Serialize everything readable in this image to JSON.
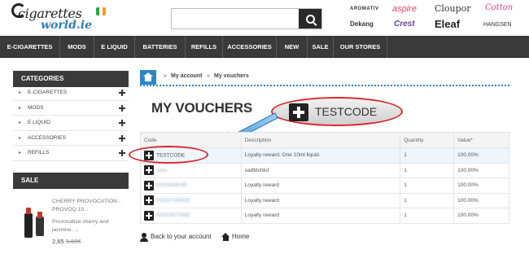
{
  "header": {
    "logo": {
      "main": "cigarettes",
      "sub": "world.ie"
    },
    "search": {
      "placeholder": "",
      "value": ""
    },
    "brands": [
      "AROMATIV",
      "aspire",
      "Cloupor",
      "Cotton",
      "Dekang",
      "Crest",
      "Eleaf",
      "HANGSEN"
    ]
  },
  "nav": {
    "items": [
      "E-CIGARETTES",
      "MODS",
      "E LIQUID",
      "BATTERIES",
      "REFILLS",
      "ACCESSORIES",
      "NEW",
      "SALE",
      "OUR STORES"
    ]
  },
  "sidebar": {
    "categories_title": "CATEGORIES",
    "categories": [
      "E-CIGARETTES",
      "MODS",
      "E LIQUID",
      "ACCESSORIES",
      "REFILLS"
    ],
    "sale_title": "SALE",
    "product": {
      "name": "CHERRY PROVOCATION - PROVOQ.10...",
      "desc": "Provocative cherry and jasmine, ...",
      "price": "2,65",
      "old_price": "3,66",
      "currency": "€"
    }
  },
  "breadcrumb": {
    "items": [
      "My account",
      "My vouchers"
    ],
    "separator": "»"
  },
  "main": {
    "title": "MY VOUCHERS",
    "callout_code": "TESTCODE",
    "table": {
      "headers": [
        "Code",
        "Description",
        "Quantity",
        "Value*"
      ],
      "rows": [
        {
          "code": "TESTCODE",
          "description": "Loyalty reward. One 10ml liquid.",
          "quantity": "1",
          "value": "100.00%"
        },
        {
          "code": "xxxx",
          "description": "sadfdsfdsf",
          "quantity": "1",
          "value": "100.00%"
        },
        {
          "code": "ECIG428140",
          "description": "Loyalty reward",
          "quantity": "1",
          "value": "100.00%"
        },
        {
          "code": "ECIG7145015",
          "description": "Loyalty reward",
          "quantity": "1",
          "value": "100.00%"
        },
        {
          "code": "ECIG2677846",
          "description": "Loyalty reward",
          "quantity": "1",
          "value": "100.00%"
        }
      ]
    },
    "footer": {
      "back_label": "Back to your account",
      "home_label": "Home"
    }
  },
  "colors": {
    "nav_bg": "#3a3a3a",
    "accent_blue": "#2f86c6",
    "highlight_red": "#d7282f"
  }
}
